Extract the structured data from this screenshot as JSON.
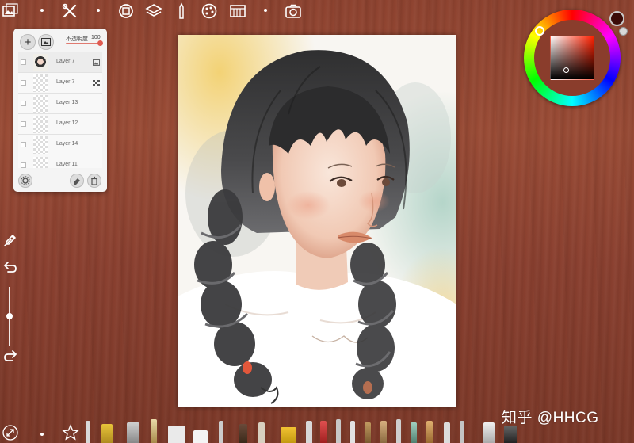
{
  "layers_panel": {
    "opacity_label": "不透明度",
    "opacity_value": "100",
    "layers": [
      {
        "name": "Layer 7",
        "type_icon": "image-icon"
      },
      {
        "name": "Layer 7",
        "type_icon": "pattern-icon"
      },
      {
        "name": "Layer 13"
      },
      {
        "name": "Layer 12"
      },
      {
        "name": "Layer 14"
      },
      {
        "name": "Layer 11"
      }
    ]
  },
  "color_picker": {
    "current_color": "#3a0b08",
    "secondary_color": "#d8d8d8",
    "hue": "#ff2000"
  },
  "watermark": "知乎 @HHCG",
  "brush_size_level": 0.5
}
